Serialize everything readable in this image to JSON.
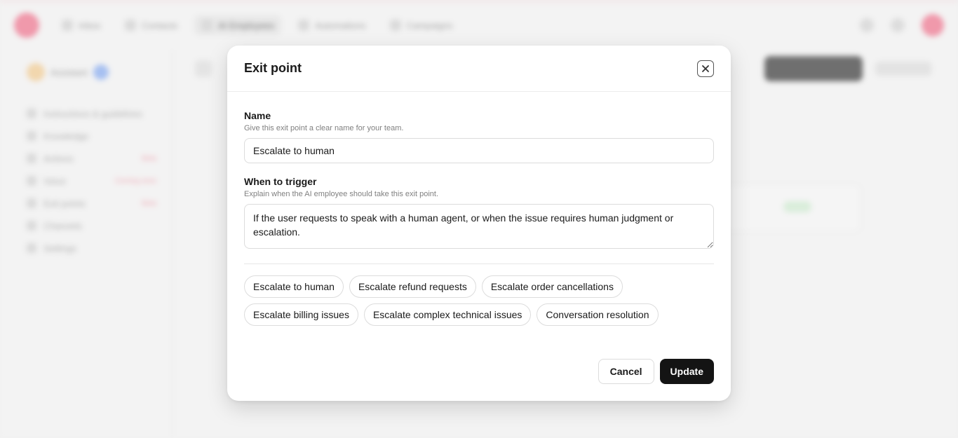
{
  "background": {
    "nav_items": [
      {
        "label": "Inbox",
        "icon": "inbox-icon",
        "active": false
      },
      {
        "label": "Contacts",
        "icon": "contacts-icon",
        "active": false
      },
      {
        "label": "AI Employees",
        "icon": "ai-employees-icon",
        "active": true
      },
      {
        "label": "Automations",
        "icon": "automations-icon",
        "active": false
      },
      {
        "label": "Campaigns",
        "icon": "campaigns-icon",
        "active": false
      }
    ],
    "sidebar": {
      "agent_name": "Assistant",
      "items": [
        {
          "label": "Instructions & guidelines",
          "tag": ""
        },
        {
          "label": "Knowledge",
          "tag": ""
        },
        {
          "label": "Actions",
          "tag": "Beta"
        },
        {
          "label": "Voice",
          "tag": "Coming soon"
        },
        {
          "label": "Exit points",
          "tag": "Beta"
        },
        {
          "label": "Channels",
          "tag": ""
        },
        {
          "label": "Settings",
          "tag": ""
        }
      ]
    }
  },
  "modal": {
    "title": "Exit point",
    "close_icon": "close-icon",
    "name_field": {
      "label": "Name",
      "help": "Give this exit point a clear name for your team.",
      "value": "Escalate to human"
    },
    "trigger_field": {
      "label": "When to trigger",
      "help": "Explain when the AI employee should take this exit point.",
      "value": "If the user requests to speak with a human agent, or when the issue requires human judgment or escalation."
    },
    "suggestions": [
      "Escalate to human",
      "Escalate refund requests",
      "Escalate order cancellations",
      "Escalate billing issues",
      "Escalate complex technical issues",
      "Conversation resolution"
    ],
    "cancel_label": "Cancel",
    "update_label": "Update"
  },
  "colors": {
    "primary_button": "#141414",
    "brand": "#f06a86",
    "border": "#dcdcdc"
  }
}
